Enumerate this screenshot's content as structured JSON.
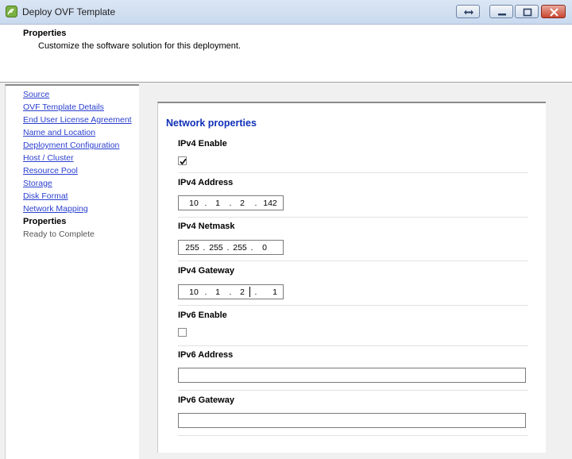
{
  "window": {
    "title": "Deploy OVF Template",
    "icon": "vsphere-app-icon",
    "buttons": [
      "swap-icon",
      "minimize-icon",
      "maximize-icon",
      "close-icon"
    ]
  },
  "header": {
    "title": "Properties",
    "subtitle": "Customize the software solution for this deployment."
  },
  "sidebar": {
    "items": [
      {
        "label": "Source",
        "state": "link"
      },
      {
        "label": "OVF Template Details",
        "state": "link"
      },
      {
        "label": "End User License Agreement",
        "state": "link"
      },
      {
        "label": "Name and Location",
        "state": "link"
      },
      {
        "label": "Deployment Configuration",
        "state": "link"
      },
      {
        "label": "Host / Cluster",
        "state": "link"
      },
      {
        "label": "Resource Pool",
        "state": "link"
      },
      {
        "label": "Storage",
        "state": "link"
      },
      {
        "label": "Disk Format",
        "state": "link"
      },
      {
        "label": "Network Mapping",
        "state": "link"
      },
      {
        "label": "Properties",
        "state": "current"
      },
      {
        "label": "Ready to Complete",
        "state": "pending"
      }
    ]
  },
  "network": {
    "title": "Network properties",
    "ipv4_enable": {
      "label": "IPv4 Enable",
      "checked": true
    },
    "ipv4_address": {
      "label": "IPv4 Address",
      "octets": [
        "10",
        "1",
        "2",
        "142"
      ]
    },
    "ipv4_netmask": {
      "label": "IPv4 Netmask",
      "octets": [
        "255",
        "255",
        "255",
        "0"
      ]
    },
    "ipv4_gateway": {
      "label": "IPv4 Gateway",
      "octets": [
        "10",
        "1",
        "2",
        "1"
      ]
    },
    "ipv6_enable": {
      "label": "IPv6 Enable",
      "checked": false
    },
    "ipv6_address": {
      "label": "IPv6 Address",
      "value": ""
    },
    "ipv6_gateway": {
      "label": "IPv6 Gateway",
      "value": ""
    }
  },
  "colors": {
    "link": "#2a3fd0",
    "section_title": "#1030b8",
    "close_button": "#c8452f"
  }
}
